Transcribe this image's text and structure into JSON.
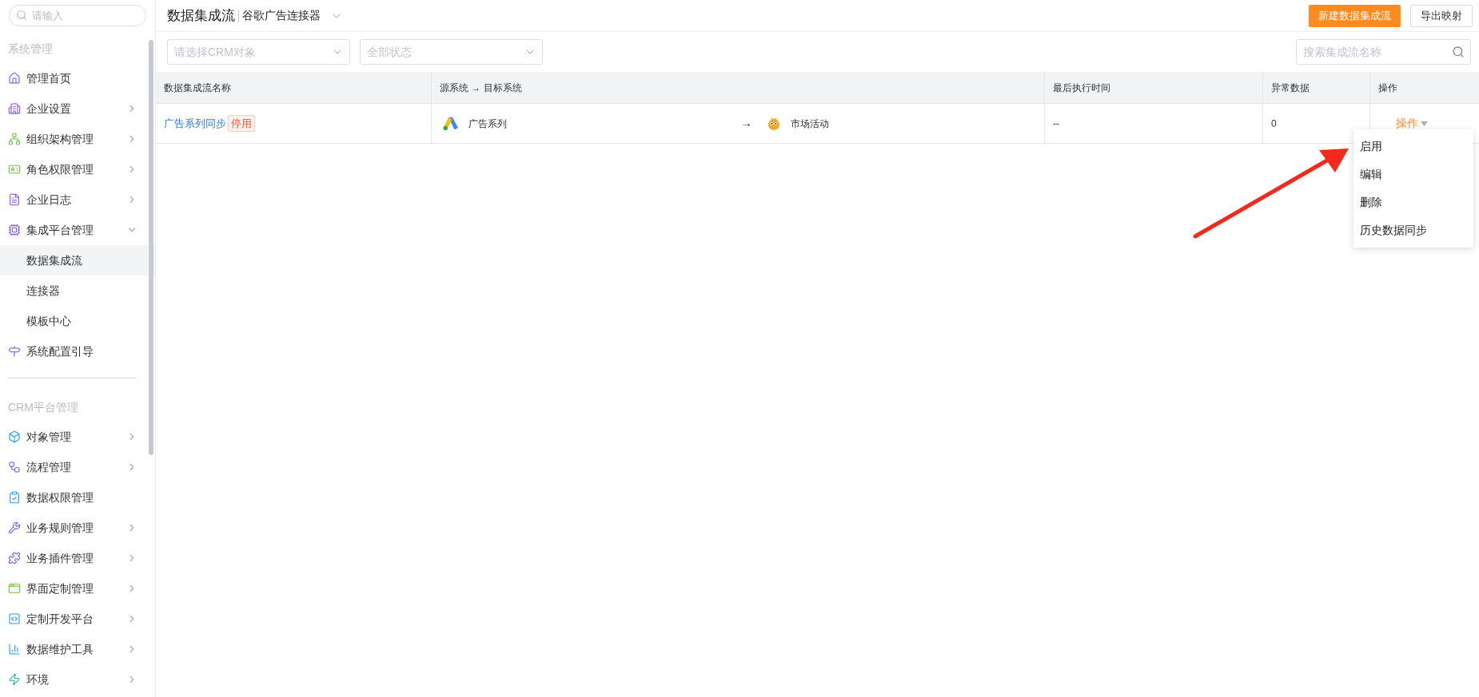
{
  "sidebar": {
    "search": {
      "placeholder": "请输入"
    },
    "sections": [
      {
        "title": "系统管理",
        "items": [
          {
            "label": "管理首页",
            "kind": "link"
          },
          {
            "label": "企业设置",
            "kind": "group",
            "expanded": false
          },
          {
            "label": "组织架构管理",
            "kind": "group",
            "expanded": false
          },
          {
            "label": "角色权限管理",
            "kind": "group",
            "expanded": false
          },
          {
            "label": "企业日志",
            "kind": "group",
            "expanded": false
          },
          {
            "label": "集成平台管理",
            "kind": "group",
            "expanded": true,
            "children": [
              {
                "label": "数据集成流",
                "selected": true
              },
              {
                "label": "连接器",
                "selected": false
              },
              {
                "label": "模板中心",
                "selected": false
              }
            ]
          },
          {
            "label": "系统配置引导",
            "kind": "link"
          }
        ]
      },
      {
        "title": "CRM平台管理",
        "items": [
          {
            "label": "对象管理",
            "kind": "group",
            "expanded": false
          },
          {
            "label": "流程管理",
            "kind": "group",
            "expanded": false
          },
          {
            "label": "数据权限管理",
            "kind": "link"
          },
          {
            "label": "业务规则管理",
            "kind": "group",
            "expanded": false
          },
          {
            "label": "业务插件管理",
            "kind": "group",
            "expanded": false
          },
          {
            "label": "界面定制管理",
            "kind": "group",
            "expanded": false
          },
          {
            "label": "定制开发平台",
            "kind": "group",
            "expanded": false
          },
          {
            "label": "数据维护工具",
            "kind": "group",
            "expanded": false
          },
          {
            "label": "环境",
            "kind": "group",
            "expanded": false
          }
        ]
      }
    ]
  },
  "header": {
    "title": "数据集成流",
    "connector": "谷歌广告连接器",
    "buttons": [
      {
        "label": "新建数据集成流",
        "kind": "primary"
      },
      {
        "label": "导出映射",
        "kind": "default"
      }
    ]
  },
  "filters": [
    {
      "placeholder": "请选择CRM对象"
    },
    {
      "placeholder": "全部状态"
    }
  ],
  "search": {
    "placeholder": "搜索集成流名称"
  },
  "table": {
    "columns": [
      "数据集成流名称",
      "源系统 → 目标系统",
      "最后执行时间",
      "异常数据",
      "操作"
    ],
    "rows": [
      {
        "name": "广告系列同步",
        "status": "停用",
        "source": "广告系列",
        "arrow": "→",
        "target": "市场活动",
        "last_run": "--",
        "errors": "0",
        "action": "操作"
      }
    ]
  },
  "menu": {
    "items": [
      "启用",
      "编辑",
      "删除",
      "历史数据同步"
    ]
  }
}
